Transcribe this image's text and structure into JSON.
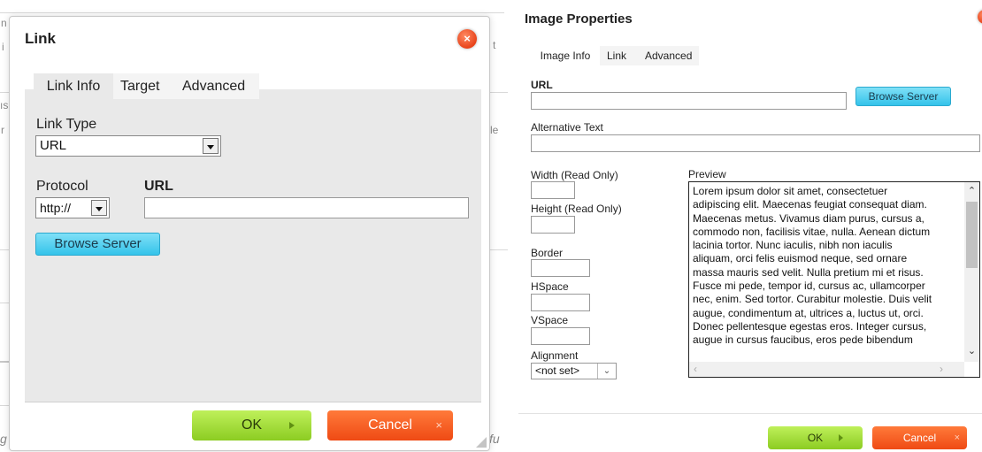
{
  "background": {
    "frag_1": "n",
    "frag_2": "i",
    "frag_3": "ıs",
    "frag_4": "r",
    "frag_5": "t",
    "frag_6": "le",
    "frag_7": "g",
    "frag_8": "fu"
  },
  "link_dialog": {
    "title": "Link",
    "tabs": [
      "Link Info",
      "Target",
      "Advanced"
    ],
    "link_type_label": "Link Type",
    "link_type_value": "URL",
    "protocol_label": "Protocol",
    "protocol_value": "http://",
    "url_label": "URL",
    "url_value": "",
    "browse_label": "Browse Server",
    "ok_label": "OK",
    "cancel_label": "Cancel"
  },
  "image_dialog": {
    "title": "Image Properties",
    "tabs": [
      "Image Info",
      "Link",
      "Advanced"
    ],
    "url_label": "URL",
    "url_value": "",
    "browse_label": "Browse Server",
    "alt_label": "Alternative Text",
    "alt_value": "",
    "width_label": "Width (Read Only)",
    "height_label": "Height (Read Only)",
    "border_label": "Border",
    "hspace_label": "HSpace",
    "vspace_label": "VSpace",
    "alignment_label": "Alignment",
    "alignment_value": "<not set>",
    "preview_label": "Preview",
    "preview_lines": [
      "Lorem ipsum dolor sit amet, consectetuer",
      "adipiscing elit. Maecenas feugiat consequat diam.",
      "Maecenas metus. Vivamus diam purus, cursus a,",
      "commodo non, facilisis vitae, nulla. Aenean dictum",
      "lacinia tortor. Nunc iaculis, nibh non iaculis",
      "aliquam, orci felis euismod neque, sed ornare",
      "massa mauris sed velit. Nulla pretium mi et risus.",
      "Fusce mi pede, tempor id, cursus ac, ullamcorper",
      "nec, enim. Sed tortor. Curabitur molestie. Duis velit",
      "augue, condimentum at, ultrices a, luctus ut, orci.",
      "Donec pellentesque egestas eros. Integer cursus,",
      "augue in cursus faucibus, eros pede bibendum"
    ],
    "ok_label": "OK",
    "cancel_label": "Cancel"
  },
  "colors": {
    "close_button": "#e8431a",
    "browse_button": "#34c3ea",
    "ok_button": "#8ccc22",
    "cancel_button": "#ef4a14"
  }
}
